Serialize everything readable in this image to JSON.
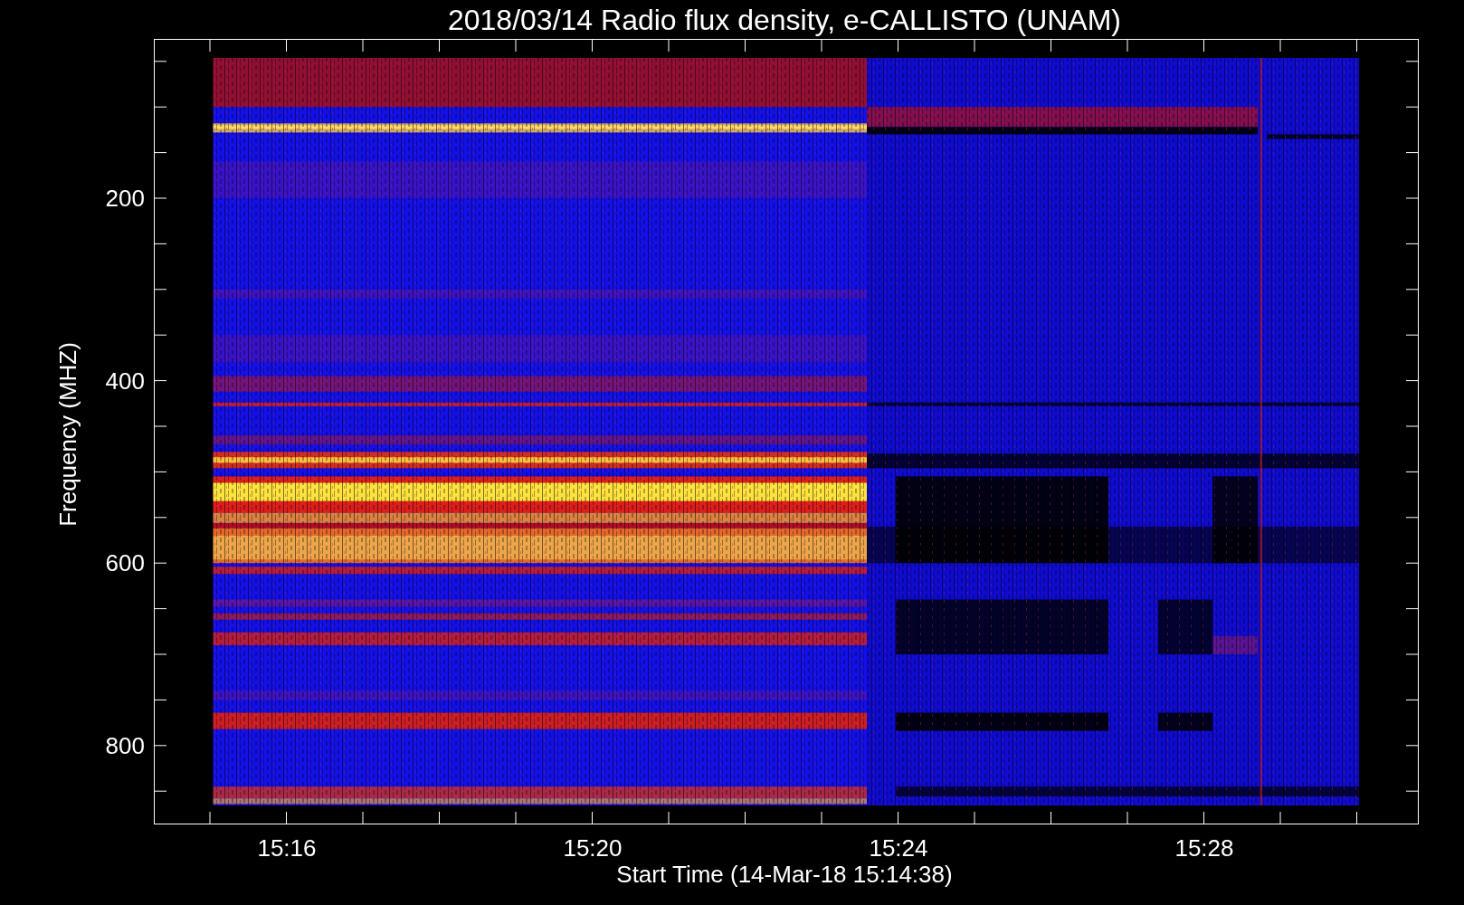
{
  "title": "2018/03/14  Radio flux density, e-CALLISTO (UNAM)",
  "axes": {
    "y_label": "Frequency (MHZ)",
    "y_ticks": [
      "200",
      "400",
      "600",
      "800"
    ],
    "x_ticks": [
      "15:16",
      "15:20",
      "15:24",
      "15:28"
    ],
    "x_label": "Start Time (14-Mar-18 15:14:38)"
  }
}
